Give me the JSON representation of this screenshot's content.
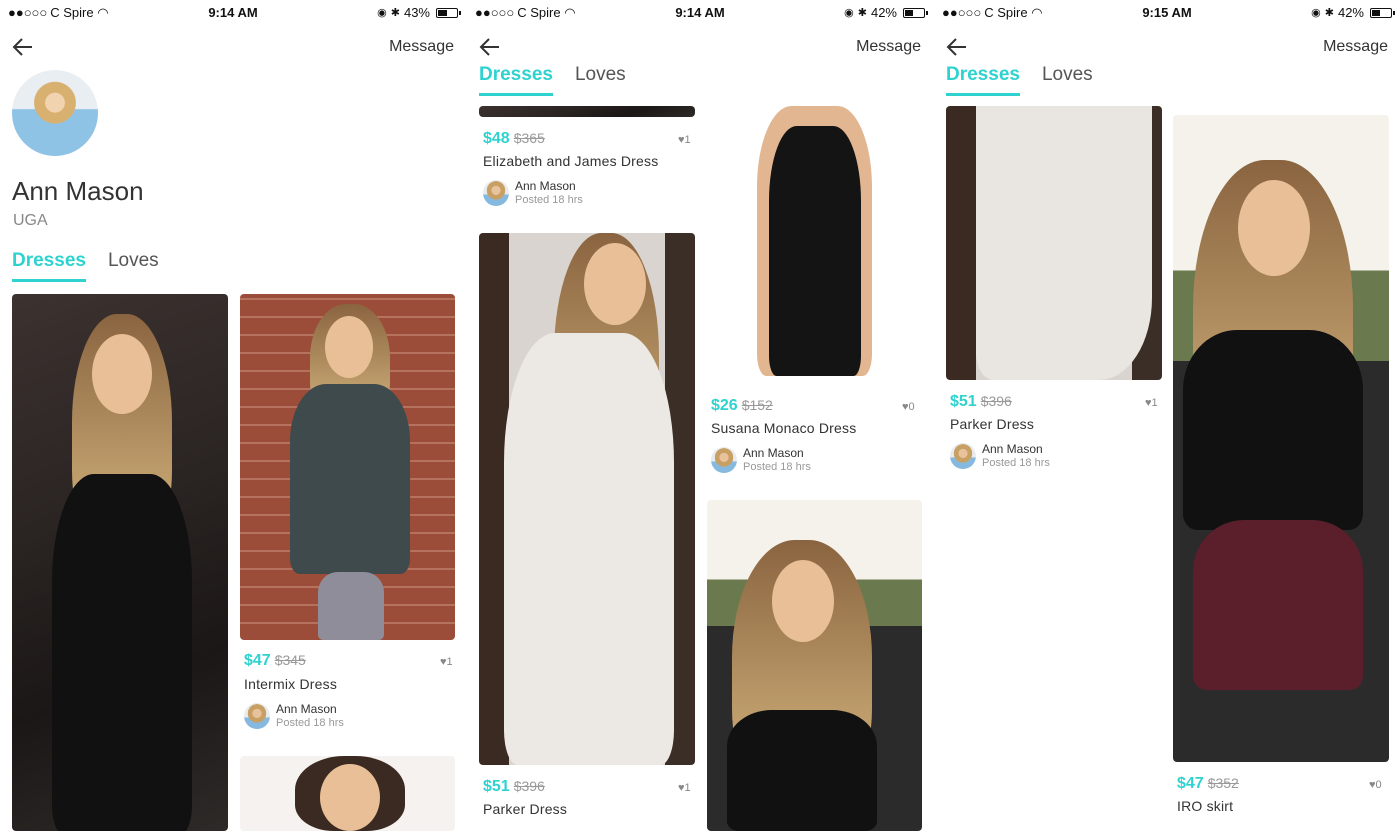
{
  "status": [
    {
      "carrier": "C Spire",
      "time": "9:14 AM",
      "battery": "43%",
      "battery_level": 0.43
    },
    {
      "carrier": "C Spire",
      "time": "9:14 AM",
      "battery": "42%",
      "battery_level": 0.42
    },
    {
      "carrier": "C Spire",
      "time": "9:15 AM",
      "battery": "42%",
      "battery_level": 0.42
    }
  ],
  "nav": {
    "message_label": "Message"
  },
  "profile": {
    "name": "Ann Mason",
    "school": "UGA"
  },
  "tabs": {
    "dresses": "Dresses",
    "loves": "Loves"
  },
  "listings": {
    "elizabeth": {
      "price": "$48",
      "original": "$365",
      "likes": "♥1",
      "title": "Elizabeth and James Dress"
    },
    "intermix": {
      "price": "$47",
      "original": "$345",
      "likes": "♥1",
      "title": "Intermix Dress"
    },
    "susana": {
      "price": "$26",
      "original": "$152",
      "likes": "♥0",
      "title": "Susana Monaco Dress"
    },
    "parker": {
      "price": "$51",
      "original": "$396",
      "likes": "♥1",
      "title": "Parker Dress"
    },
    "iro": {
      "price": "$47",
      "original": "$352",
      "likes": "♥0",
      "title": "IRO skirt"
    }
  },
  "poster": {
    "name": "Ann Mason",
    "posted": "Posted 18 hrs"
  },
  "colors": {
    "accent": "#2ed3cf",
    "text": "#333333",
    "muted": "#999999"
  },
  "icons": [
    "signal-icon",
    "wifi-icon",
    "alarm-icon",
    "bluetooth-icon",
    "battery-icon",
    "back-arrow-icon",
    "heart-icon"
  ]
}
